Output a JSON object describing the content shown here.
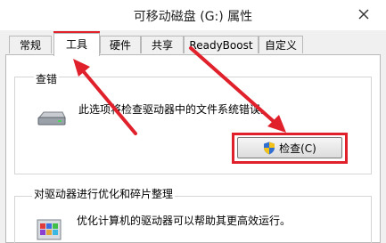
{
  "window": {
    "title": "可移动磁盘 (G:) 属性"
  },
  "tabs": [
    {
      "label": "常规"
    },
    {
      "label": "工具",
      "active": true
    },
    {
      "label": "硬件"
    },
    {
      "label": "共享"
    },
    {
      "label": "ReadyBoost"
    },
    {
      "label": "自定义"
    }
  ],
  "error_check": {
    "heading": "查错",
    "description": "此选项将检查驱动器中的文件系统错误。",
    "button_label": "检查(C)"
  },
  "optimize": {
    "heading": "对驱动器进行优化和碎片整理",
    "description": "优化计算机的驱动器可以帮助其更高效运行。"
  },
  "icons": [
    "close-icon",
    "drive-icon",
    "uac-shield-icon",
    "defrag-icon"
  ],
  "colors": {
    "annotation": "#e0202a",
    "close_hover": "#c42b1c"
  }
}
